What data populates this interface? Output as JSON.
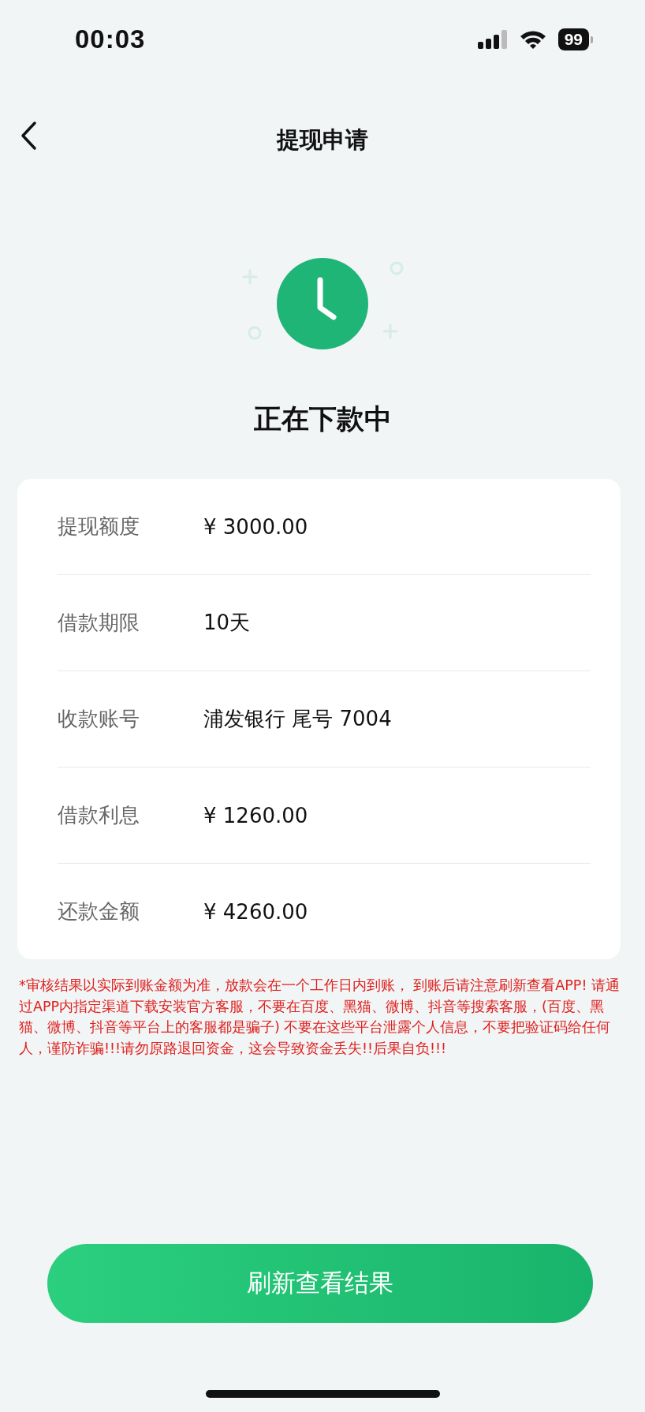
{
  "status_bar": {
    "time": "00:03",
    "battery": "99"
  },
  "nav": {
    "title": "提现申请"
  },
  "status": {
    "title": "正在下款中"
  },
  "details": [
    {
      "label": "提现额度",
      "value": "¥ 3000.00"
    },
    {
      "label": "借款期限",
      "value": "10天"
    },
    {
      "label": "收款账号",
      "value": "浦发银行 尾号 7004"
    },
    {
      "label": "借款利息",
      "value": "¥ 1260.00"
    },
    {
      "label": "还款金额",
      "value": "¥ 4260.00"
    }
  ],
  "notice": "*审核结果以实际到账金额为准，放款会在一个工作日内到账， 到账后请注意刷新查看APP! 请通过APP内指定渠道下载安装官方客服，不要在百度、黑猫、微博、抖音等搜索客服，(百度、黑猫、微博、抖音等平台上的客服都是骗子) 不要在这些平台泄露个人信息，不要把验证码给任何人，谨防诈骗!!!请勿原路退回资金，这会导致资金丢失!!后果自负!!!",
  "button": "刷新查看结果"
}
